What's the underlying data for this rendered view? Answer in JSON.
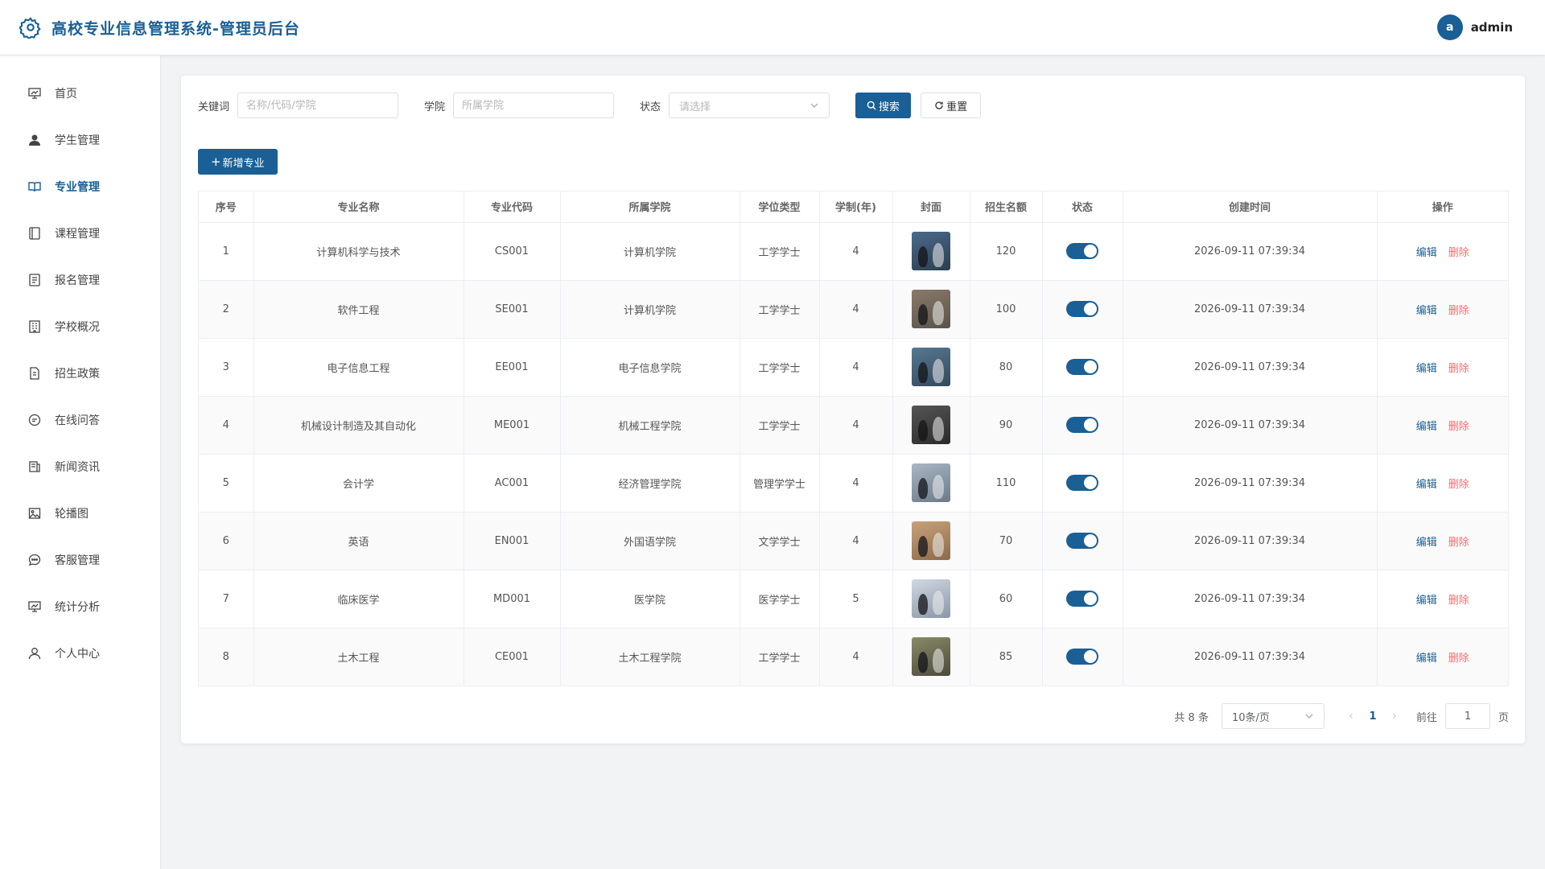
{
  "header": {
    "title": "高校专业信息管理系统-管理员后台",
    "avatar_letter": "a",
    "username": "admin"
  },
  "sidebar": {
    "items": [
      {
        "label": "首页",
        "icon": "dashboard-icon"
      },
      {
        "label": "学生管理",
        "icon": "user-icon"
      },
      {
        "label": "专业管理",
        "icon": "book-icon",
        "active": true
      },
      {
        "label": "课程管理",
        "icon": "notebook-icon"
      },
      {
        "label": "报名管理",
        "icon": "document-icon"
      },
      {
        "label": "学校概况",
        "icon": "building-icon"
      },
      {
        "label": "招生政策",
        "icon": "policy-icon"
      },
      {
        "label": "在线问答",
        "icon": "chat-icon"
      },
      {
        "label": "新闻资讯",
        "icon": "news-icon"
      },
      {
        "label": "轮播图",
        "icon": "picture-icon"
      },
      {
        "label": "客服管理",
        "icon": "service-icon"
      },
      {
        "label": "统计分析",
        "icon": "chart-icon"
      },
      {
        "label": "个人中心",
        "icon": "person-icon"
      }
    ]
  },
  "filters": {
    "keyword_label": "关键词",
    "keyword_placeholder": "名称/代码/学院",
    "college_label": "学院",
    "college_placeholder": "所属学院",
    "status_label": "状态",
    "status_placeholder": "请选择",
    "search_label": "搜索",
    "reset_label": "重置"
  },
  "add_label": "新增专业",
  "table": {
    "columns": [
      "序号",
      "专业名称",
      "专业代码",
      "所属学院",
      "学位类型",
      "学制(年)",
      "封面",
      "招生名额",
      "状态",
      "创建时间",
      "操作"
    ],
    "rows": [
      {
        "idx": "1",
        "name": "计算机科学与技术",
        "code": "CS001",
        "college": "计算机学院",
        "degree": "工学学士",
        "years": "4",
        "quota": "120",
        "created": "2026-09-11 07:39:34"
      },
      {
        "idx": "2",
        "name": "软件工程",
        "code": "SE001",
        "college": "计算机学院",
        "degree": "工学学士",
        "years": "4",
        "quota": "100",
        "created": "2026-09-11 07:39:34"
      },
      {
        "idx": "3",
        "name": "电子信息工程",
        "code": "EE001",
        "college": "电子信息学院",
        "degree": "工学学士",
        "years": "4",
        "quota": "80",
        "created": "2026-09-11 07:39:34"
      },
      {
        "idx": "4",
        "name": "机械设计制造及其自动化",
        "code": "ME001",
        "college": "机械工程学院",
        "degree": "工学学士",
        "years": "4",
        "quota": "90",
        "created": "2026-09-11 07:39:34"
      },
      {
        "idx": "5",
        "name": "会计学",
        "code": "AC001",
        "college": "经济管理学院",
        "degree": "管理学学士",
        "years": "4",
        "quota": "110",
        "created": "2026-09-11 07:39:34"
      },
      {
        "idx": "6",
        "name": "英语",
        "code": "EN001",
        "college": "外国语学院",
        "degree": "文学学士",
        "years": "4",
        "quota": "70",
        "created": "2026-09-11 07:39:34"
      },
      {
        "idx": "7",
        "name": "临床医学",
        "code": "MD001",
        "college": "医学院",
        "degree": "医学学士",
        "years": "5",
        "quota": "60",
        "created": "2026-09-11 07:39:34"
      },
      {
        "idx": "8",
        "name": "土木工程",
        "code": "CE001",
        "college": "土木工程学院",
        "degree": "工学学士",
        "years": "4",
        "quota": "85",
        "created": "2026-09-11 07:39:34"
      }
    ],
    "edit_label": "编辑",
    "delete_label": "删除"
  },
  "pagination": {
    "total_text": "共 8 条",
    "page_size": "10条/页",
    "current_page": "1",
    "goto_label": "前往",
    "goto_value": "1",
    "page_suffix": "页"
  },
  "colors": {
    "primary": "#1a5f95",
    "danger": "#f56c6c"
  }
}
